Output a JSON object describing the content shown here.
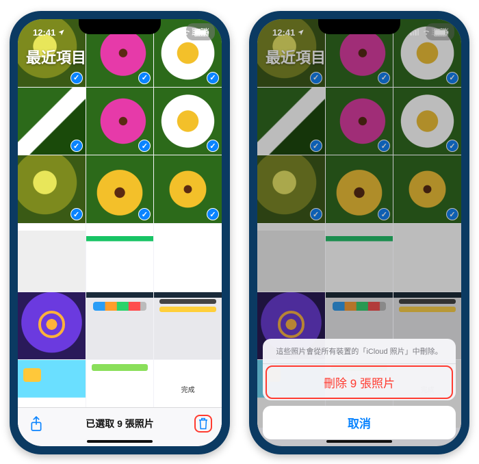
{
  "status": {
    "time": "12:41",
    "location_icon": "location-arrow",
    "signal": 4,
    "wifi": true,
    "battery": 100
  },
  "header": {
    "album_title": "最近項目",
    "cancel_label": "取消"
  },
  "grid": {
    "selected_count": 9,
    "thumbs": [
      {
        "kind": "photo",
        "bg": "f1",
        "selected": true
      },
      {
        "kind": "photo",
        "bg": "f2",
        "selected": true
      },
      {
        "kind": "photo",
        "bg": "f3",
        "selected": true
      },
      {
        "kind": "photo",
        "bg": "f4",
        "selected": true
      },
      {
        "kind": "photo",
        "bg": "f2",
        "selected": true
      },
      {
        "kind": "photo",
        "bg": "f3",
        "selected": true
      },
      {
        "kind": "photo",
        "bg": "f1",
        "selected": true
      },
      {
        "kind": "photo",
        "bg": "f5",
        "selected": true
      },
      {
        "kind": "photo",
        "bg": "f6",
        "selected": true
      },
      {
        "kind": "screenshot",
        "bg": "ss2",
        "selected": false
      },
      {
        "kind": "screenshot",
        "bg": "ss1",
        "selected": false
      },
      {
        "kind": "screenshot",
        "bg": "ss3",
        "selected": false
      },
      {
        "kind": "screenshot",
        "bg": "ss4",
        "selected": false
      },
      {
        "kind": "screenshot",
        "bg": "ss5",
        "selected": false
      },
      {
        "kind": "screenshot",
        "bg": "ss6",
        "selected": false
      },
      {
        "kind": "screenshot",
        "bg": "ss7",
        "selected": false
      },
      {
        "kind": "screenshot",
        "bg": "ss8",
        "selected": false
      },
      {
        "kind": "screenshot",
        "bg": "ss9",
        "selected": false
      }
    ]
  },
  "toolbar": {
    "share_icon": "share",
    "selection_label": "已選取 9 張照片",
    "trash_icon": "trash"
  },
  "action_sheet": {
    "message": "這些照片會從所有裝置的「iCloud 照片」中刪除。",
    "delete_label": "刪除 9 張照片",
    "cancel_label": "取消"
  }
}
